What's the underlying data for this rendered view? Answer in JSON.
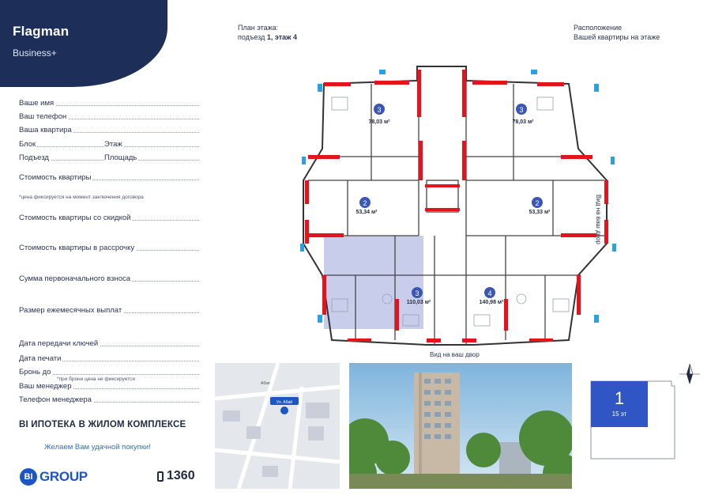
{
  "header": {
    "brand": "Flagman",
    "subtitle": "Business+"
  },
  "form": {
    "name": "Ваше имя",
    "phone": "Ваш телефон",
    "apartment": "Ваша квартира",
    "block": "Блок",
    "floor": "Этаж",
    "entrance": "Подъезд",
    "area": "Площадь",
    "price": "Стоимость квартиры",
    "price_note": "*цена фиксируется на момент заключения договора",
    "price_discount": "Стоимость квартиры со скидкой",
    "price_installment": "Стоимость квартиры в рассрочку",
    "down_payment": "Сумма первоначального взноса",
    "monthly_payment": "Размер ежемесячных выплат",
    "key_date": "Дата передачи ключей",
    "print_date": "Дата печати",
    "reserve_until": "Бронь до",
    "reserve_note": "*при брони цена не фиксируется",
    "manager": "Ваш менеджер",
    "manager_phone": "Телефон менеджера"
  },
  "promo": "BI ИПОТЕКА В ЖИЛОМ КОМПЛЕКСЕ",
  "wish": "Желаем Вам удачной покупки!",
  "footer": {
    "logo_circle": "BI",
    "logo_text": "GROUP",
    "phone": "1360"
  },
  "plan": {
    "title_line1": "План этажа:",
    "title_line2_prefix": "подъезд ",
    "title_line2_bold": "1, этаж 4",
    "location_line1": "Расположение",
    "location_line2": "Вашей квартиры на этаже",
    "side_label": "Вид на ваш двор",
    "bottom_label": "Вид на ваш двор",
    "units": [
      {
        "rooms": "3",
        "area": "78,03 м²"
      },
      {
        "rooms": "3",
        "area": "78,03 м²"
      },
      {
        "rooms": "2",
        "area": "53,34 м²"
      },
      {
        "rooms": "2",
        "area": "53,33 м²"
      },
      {
        "rooms": "3",
        "area": "110,03 м²"
      },
      {
        "rooms": "4",
        "area": "140,98 м²"
      }
    ]
  },
  "map": {
    "pin_label": "Ул. Абай",
    "street": "Абая"
  },
  "floor_widget": {
    "number": "1",
    "label": "15 эт"
  },
  "colors": {
    "navy": "#1d2f58",
    "blue": "#2f56c4",
    "wall_red": "#e3141b",
    "highlight": "#c9cdec"
  }
}
